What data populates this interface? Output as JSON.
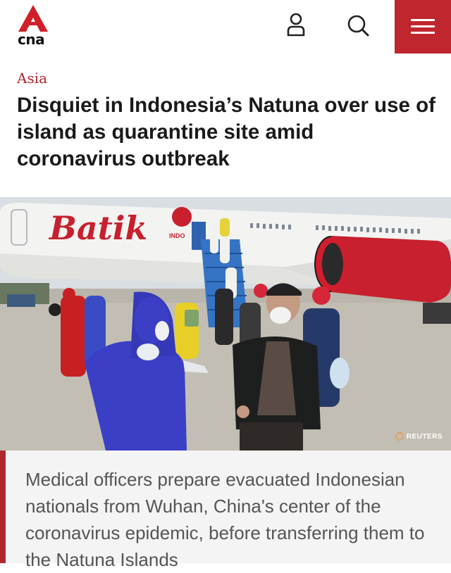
{
  "header": {
    "logo_text": "cna",
    "icons": [
      "user-icon",
      "search-icon",
      "menu-icon"
    ],
    "menu_color": "#c0262e"
  },
  "article": {
    "category": "Asia",
    "headline": "Disquiet in Indonesia’s Natuna over use of island as quarantine site amid coronavirus outbreak",
    "image": {
      "aircraft_livery": "Batik",
      "aircraft_livery_small": "INDO",
      "credit": "REUTERS"
    },
    "caption": "Medical officers prepare evacuated Indonesian nationals from Wuhan, China's center of the coronavirus epidemic, before transferring them to the Natuna Islands"
  },
  "colors": {
    "accent": "#b0262f",
    "text": "#1a1a1a",
    "caption_text": "#555555"
  }
}
